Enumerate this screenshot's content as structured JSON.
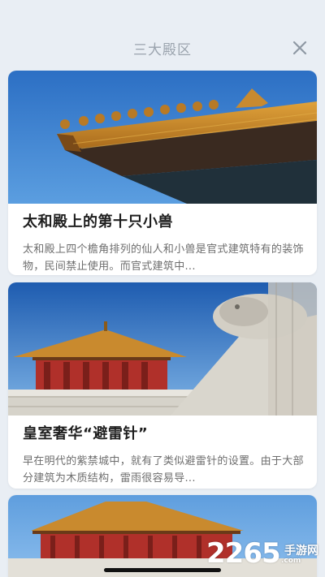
{
  "header": {
    "title": "三大殿区",
    "close_icon": "close-icon"
  },
  "cards": [
    {
      "headline": "太和殿上的第十只小兽",
      "summary": "太和殿上四个檐角排列的仙人和小兽是官式建筑特有的装饰物，民间禁止使用。而官式建筑中..."
    },
    {
      "headline": "皇室奢华“避雷针”",
      "summary": "早在明代的紫禁城中，就有了类似避雷针的设置。由于大部分建筑为木质结构，雷雨很容易导..."
    },
    {
      "headline": "",
      "summary": ""
    }
  ],
  "watermark": {
    "number": "2265",
    "site": "手游网",
    "url": ".com"
  },
  "colors": {
    "background": "#e9eef4",
    "title": "#9aa3ad",
    "headline": "#1e1e1e",
    "summary": "#6e6e6e",
    "sky": "#2f7fd1",
    "roof_gold": "#c98a2e",
    "pillar_red": "#b0302a"
  }
}
